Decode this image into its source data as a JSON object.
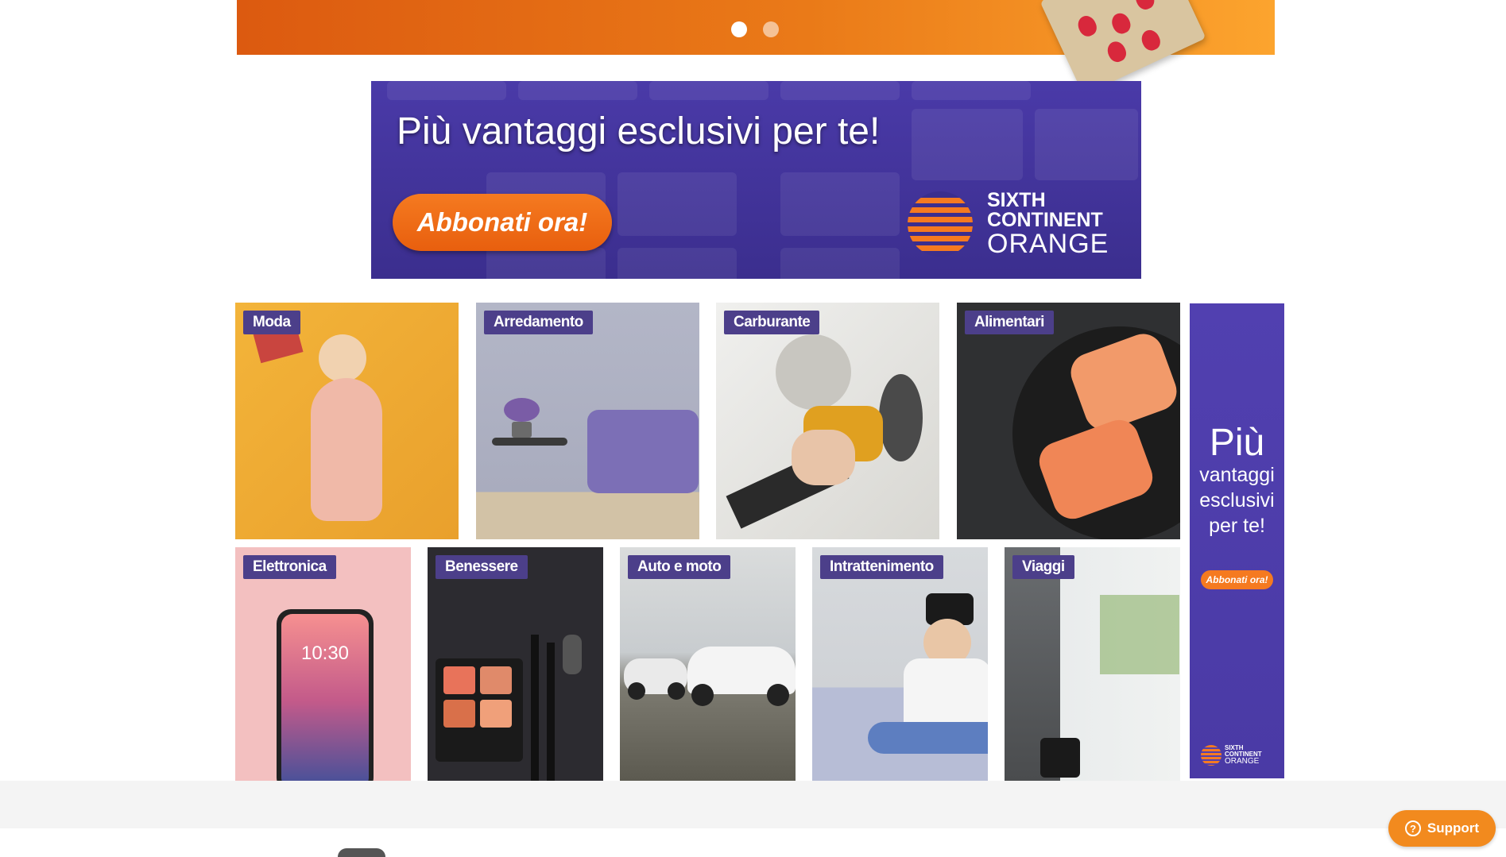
{
  "hero": {
    "slides": [
      {
        "active": true
      },
      {
        "active": false
      }
    ]
  },
  "promo_banner": {
    "title": "Più vantaggi esclusivi per te!",
    "cta": "Abbonati ora!",
    "brand": {
      "line1": "SIXTH",
      "line2": "CONTINENT",
      "line3": "ORANGE"
    }
  },
  "categories": [
    {
      "label": "Moda"
    },
    {
      "label": "Arredamento"
    },
    {
      "label": "Carburante"
    },
    {
      "label": "Alimentari"
    },
    {
      "label": "Elettronica"
    },
    {
      "label": "Benessere"
    },
    {
      "label": "Auto e moto"
    },
    {
      "label": "Intrattenimento"
    },
    {
      "label": "Viaggi"
    }
  ],
  "skyscraper_ad": {
    "line1": "Più",
    "line2": "vantaggi",
    "line3": "esclusivi",
    "line4": "per te!",
    "cta": "Abbonati ora!",
    "brand": {
      "line1": "SIXTH",
      "line2": "CONTINENT",
      "line3": "ORANGE"
    }
  },
  "support": {
    "label": "Support",
    "icon": "question-circle-icon"
  },
  "colors": {
    "brand_purple": "#4c3f8a",
    "brand_orange": "#f57a20",
    "support_orange": "#f28a1e"
  }
}
